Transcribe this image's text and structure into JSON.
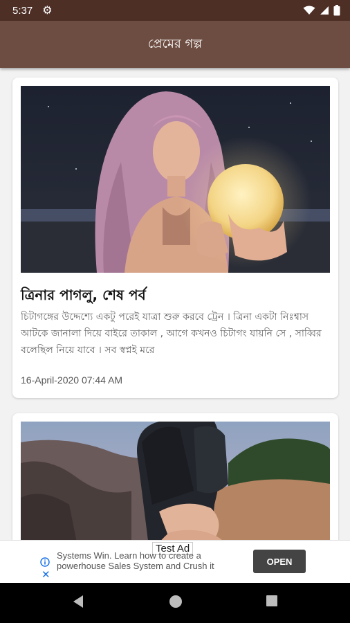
{
  "status_bar": {
    "time": "5:37",
    "icons": [
      "settings-icon",
      "wifi-icon",
      "signal-icon",
      "battery-icon"
    ]
  },
  "app_bar": {
    "title": "প্রেমের গল্প"
  },
  "posts": [
    {
      "title": "ত্রিনার পাগলু, শেষ পর্ব",
      "excerpt": "চিটাগঙ্গের উদ্দেশ্যে একটু পরেই যাত্রা শুরু করবে ট্রেন । ত্রিনা একটা নিঃশ্বাস আটকে জানালা দিয়ে বাইরে তাকাল , আগে কখনও চিটাগং যায়নি সে , সাব্বির বলেছিল নিয়ে যাবে । সব স্বপ্নই মরে",
      "date": "16-April-2020 07:44 AM",
      "image": "woman-holding-moon-lamp"
    },
    {
      "title": "",
      "excerpt": "",
      "date": "",
      "image": "holding-hands-by-the-sea"
    }
  ],
  "ad": {
    "label": "Test Ad",
    "text": "Systems Win. Learn how to create a powerhouse Sales System and Crush it",
    "button": "OPEN",
    "icons": [
      "ad-info-icon",
      "ad-close-icon"
    ]
  },
  "nav_bar": {
    "icons": [
      "back-icon",
      "home-icon",
      "recents-icon"
    ]
  },
  "colors": {
    "status_bar": "#4e2f26",
    "app_bar": "#6d4c41",
    "background": "#f2f2f2",
    "ad_button": "#444444"
  }
}
